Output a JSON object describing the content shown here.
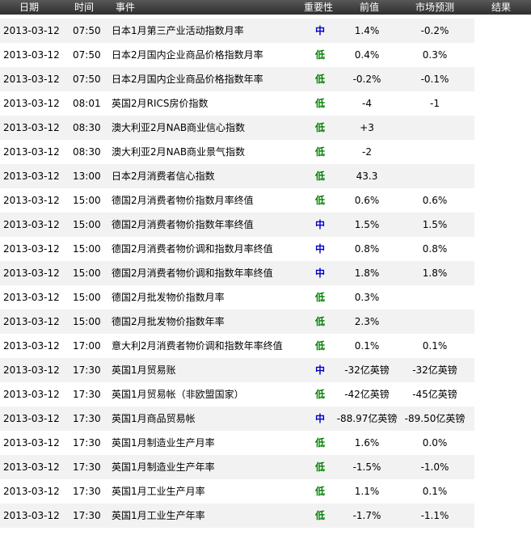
{
  "header": {
    "date": "日期",
    "time": "时间",
    "event": "事件",
    "importance": "重要性",
    "previous": "前值",
    "forecast": "市场预测",
    "result": "结果"
  },
  "rows": [
    {
      "date": "2013-03-12",
      "time": "07:50",
      "event": "日本1月第三产业活动指数月率",
      "importance": "中",
      "previous": "1.4%",
      "forecast": "-0.2%"
    },
    {
      "date": "2013-03-12",
      "time": "07:50",
      "event": "日本2月国内企业商品价格指数月率",
      "importance": "低",
      "previous": "0.4%",
      "forecast": "0.3%"
    },
    {
      "date": "2013-03-12",
      "time": "07:50",
      "event": "日本2月国内企业商品价格指数年率",
      "importance": "低",
      "previous": "-0.2%",
      "forecast": "-0.1%"
    },
    {
      "date": "2013-03-12",
      "time": "08:01",
      "event": "英国2月RICS房价指数",
      "importance": "低",
      "previous": "-4",
      "forecast": "-1"
    },
    {
      "date": "2013-03-12",
      "time": "08:30",
      "event": "澳大利亚2月NAB商业信心指数",
      "importance": "低",
      "previous": "+3",
      "forecast": ""
    },
    {
      "date": "2013-03-12",
      "time": "08:30",
      "event": "澳大利亚2月NAB商业景气指数",
      "importance": "低",
      "previous": "-2",
      "forecast": ""
    },
    {
      "date": "2013-03-12",
      "time": "13:00",
      "event": "日本2月消费者信心指数",
      "importance": "低",
      "previous": "43.3",
      "forecast": ""
    },
    {
      "date": "2013-03-12",
      "time": "15:00",
      "event": "德国2月消费者物价指数月率终值",
      "importance": "低",
      "previous": "0.6%",
      "forecast": "0.6%"
    },
    {
      "date": "2013-03-12",
      "time": "15:00",
      "event": "德国2月消费者物价指数年率终值",
      "importance": "中",
      "previous": "1.5%",
      "forecast": "1.5%"
    },
    {
      "date": "2013-03-12",
      "time": "15:00",
      "event": "德国2月消费者物价调和指数月率终值",
      "importance": "中",
      "previous": "0.8%",
      "forecast": "0.8%"
    },
    {
      "date": "2013-03-12",
      "time": "15:00",
      "event": "德国2月消费者物价调和指数年率终值",
      "importance": "中",
      "previous": "1.8%",
      "forecast": "1.8%"
    },
    {
      "date": "2013-03-12",
      "time": "15:00",
      "event": "德国2月批发物价指数月率",
      "importance": "低",
      "previous": "0.3%",
      "forecast": ""
    },
    {
      "date": "2013-03-12",
      "time": "15:00",
      "event": "德国2月批发物价指数年率",
      "importance": "低",
      "previous": "2.3%",
      "forecast": ""
    },
    {
      "date": "2013-03-12",
      "time": "17:00",
      "event": "意大利2月消费者物价调和指数年率终值",
      "importance": "低",
      "previous": "0.1%",
      "forecast": "0.1%"
    },
    {
      "date": "2013-03-12",
      "time": "17:30",
      "event": "英国1月贸易账",
      "importance": "中",
      "previous": "-32亿英镑",
      "forecast": "-32亿英镑"
    },
    {
      "date": "2013-03-12",
      "time": "17:30",
      "event": "英国1月贸易帐（非欧盟国家）",
      "importance": "低",
      "previous": "-42亿英镑",
      "forecast": "-45亿英镑"
    },
    {
      "date": "2013-03-12",
      "time": "17:30",
      "event": "英国1月商品贸易帐",
      "importance": "中",
      "previous": "-88.97亿英镑",
      "forecast": "-89.50亿英镑"
    },
    {
      "date": "2013-03-12",
      "time": "17:30",
      "event": "英国1月制造业生产月率",
      "importance": "低",
      "previous": "1.6%",
      "forecast": "0.0%"
    },
    {
      "date": "2013-03-12",
      "time": "17:30",
      "event": "英国1月制造业生产年率",
      "importance": "低",
      "previous": "-1.5%",
      "forecast": "-1.0%"
    },
    {
      "date": "2013-03-12",
      "time": "17:30",
      "event": "英国1月工业生产月率",
      "importance": "低",
      "previous": "1.1%",
      "forecast": "0.1%"
    },
    {
      "date": "2013-03-12",
      "time": "17:30",
      "event": "英国1月工业生产年率",
      "importance": "低",
      "previous": "-1.7%",
      "forecast": "-1.1%"
    }
  ]
}
